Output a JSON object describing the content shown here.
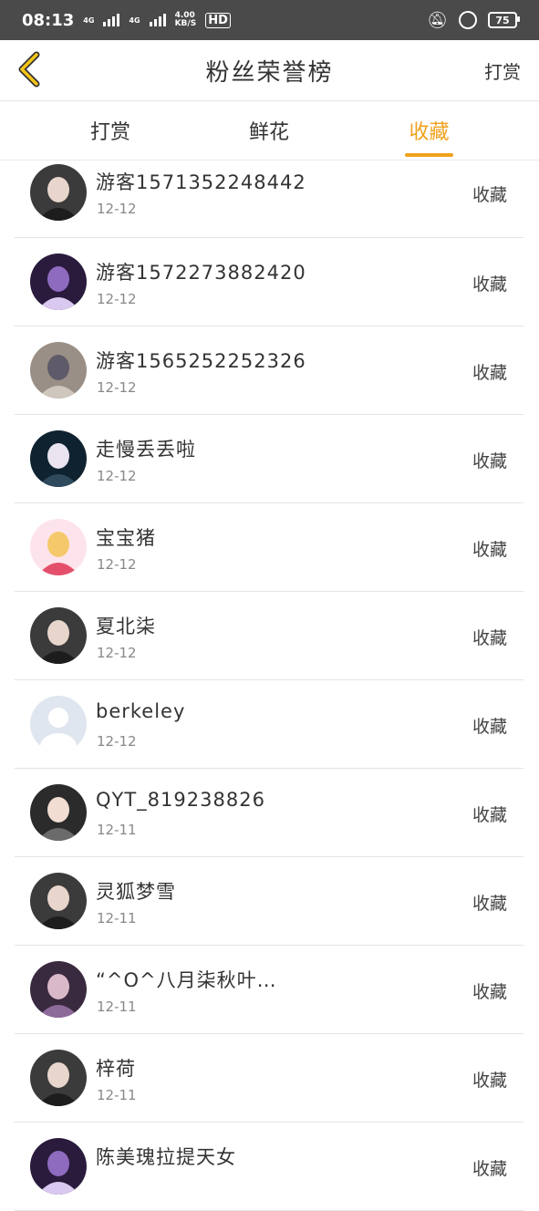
{
  "status_bar": {
    "time": "08:13",
    "net1": "4G",
    "net2": "4G",
    "speed_value": "4.00",
    "speed_unit": "KB/S",
    "hd": "HD",
    "battery": "75"
  },
  "header": {
    "title": "粉丝荣誉榜",
    "right_action": "打赏"
  },
  "tabs": [
    {
      "label": "打赏",
      "active": false
    },
    {
      "label": "鲜花",
      "active": false
    },
    {
      "label": "收藏",
      "active": true
    }
  ],
  "colors": {
    "accent": "#f0a11c",
    "status_bar": "#4a4a4a",
    "back_icon": "#f5c518"
  },
  "fans": [
    {
      "name": "游客1571352248442",
      "date": "12-12",
      "action": "收藏",
      "avatar": "photo-avatar-woman"
    },
    {
      "name": "游客1572273882420",
      "date": "12-12",
      "action": "收藏",
      "avatar": "photo-avatar-purple"
    },
    {
      "name": "游客1565252252326",
      "date": "12-12",
      "action": "收藏",
      "avatar": "photo-avatar-figure"
    },
    {
      "name": "走慢丢丢啦",
      "date": "12-12",
      "action": "收藏",
      "avatar": "photo-avatar-ballerina"
    },
    {
      "name": "宝宝猪",
      "date": "12-12",
      "action": "收藏",
      "avatar": "photo-avatar-anime-girl"
    },
    {
      "name": "夏北柒",
      "date": "12-12",
      "action": "收藏",
      "avatar": "photo-avatar-woman"
    },
    {
      "name": "berkeley",
      "date": "12-12",
      "action": "收藏",
      "avatar": "default-avatar-icon"
    },
    {
      "name": "QYT_819238826",
      "date": "12-11",
      "action": "收藏",
      "avatar": "photo-avatar-couple"
    },
    {
      "name": "灵狐梦雪",
      "date": "12-11",
      "action": "收藏",
      "avatar": "photo-avatar-woman"
    },
    {
      "name": "“^O^八月柒秋叶…",
      "date": "12-11",
      "action": "收藏",
      "avatar": "photo-avatar-costume"
    },
    {
      "name": "梓荷",
      "date": "12-11",
      "action": "收藏",
      "avatar": "photo-avatar-woman"
    },
    {
      "name": "陈美瑰拉提天女",
      "date": "",
      "action": "收藏",
      "avatar": "photo-avatar-purple"
    }
  ]
}
